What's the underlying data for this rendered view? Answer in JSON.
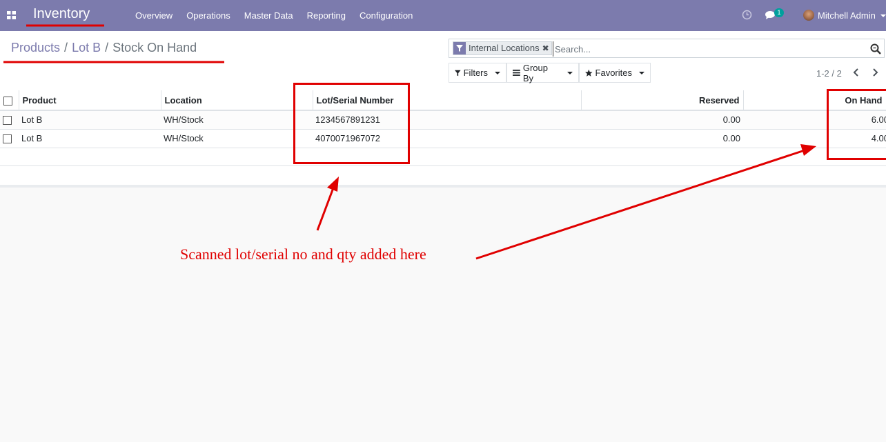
{
  "navbar": {
    "app_title": "Inventory",
    "menu": [
      "Overview",
      "Operations",
      "Master Data",
      "Reporting",
      "Configuration"
    ],
    "message_count": "1",
    "user_name": "Mitchell Admin",
    "color": "#7c7bad"
  },
  "breadcrumb": {
    "items": [
      "Products",
      "Lot B"
    ],
    "current": "Stock On Hand",
    "separator": "/"
  },
  "search": {
    "facet_label": "Internal Locations",
    "facet_remove": "✖",
    "placeholder": "Search..."
  },
  "filters": {
    "filters_label": "Filters",
    "group_by_label": "Group By",
    "favorites_label": "Favorites"
  },
  "pager": {
    "value": "1-2 / 2"
  },
  "table": {
    "columns": [
      "Product",
      "Location",
      "Lot/Serial Number",
      "Reserved",
      "On Hand"
    ],
    "rows": [
      {
        "product": "Lot B",
        "location": "WH/Stock",
        "lot": "1234567891231",
        "reserved": "0.00",
        "on_hand": "6.00"
      },
      {
        "product": "Lot B",
        "location": "WH/Stock",
        "lot": "4070071967072",
        "reserved": "0.00",
        "on_hand": "4.00"
      }
    ]
  },
  "annotation": {
    "text": "Scanned lot/serial no and qty added here",
    "color": "#e00000"
  }
}
